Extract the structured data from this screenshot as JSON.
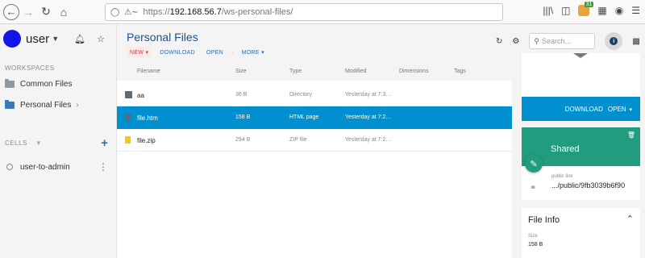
{
  "browser": {
    "url_prefix": "https://",
    "url_host": "192.168.56.7",
    "url_path": "/ws-personal-files/",
    "ext_badge": "31"
  },
  "user": {
    "name": "user"
  },
  "sidebar": {
    "workspaces_title": "WORKSPACES",
    "workspaces": [
      {
        "label": "Common Files"
      },
      {
        "label": "Personal Files"
      }
    ],
    "cells_title": "CELLS",
    "cells": [
      {
        "label": "user-to-admin"
      }
    ]
  },
  "main": {
    "title": "Personal Files",
    "toolbar": {
      "new": "NEW",
      "download": "DOWNLOAD",
      "open": "OPEN",
      "more": "MORE"
    },
    "columns": [
      "Filename",
      "Size",
      "Type",
      "Modified",
      "Dimensions",
      "Tags"
    ],
    "rows": [
      {
        "name": "aa",
        "size": "36 B",
        "type": "Directory",
        "modified": "Yesterday at 7:3…",
        "icon": "folder-icon",
        "selected": false
      },
      {
        "name": "file.htm",
        "size": "158 B",
        "type": "HTML page",
        "modified": "Yesterday at 7:2…",
        "icon": "document-icon",
        "selected": true
      },
      {
        "name": "file.zip",
        "size": "294 B",
        "type": "ZIP file",
        "modified": "Yesterday at 7:2…",
        "icon": "archive-icon",
        "selected": false
      }
    ]
  },
  "header": {
    "search_placeholder": "Search..."
  },
  "details": {
    "download": "DOWNLOAD",
    "open": "OPEN",
    "shared_title": "Shared",
    "public_link_label": "public link",
    "public_link_value": ".../public/9fb3039b6f90",
    "file_info_title": "File Info",
    "size_label": "Size",
    "size_value": "158 B"
  },
  "colors": {
    "accent": "#0090d0",
    "shared": "#219c7f",
    "title": "#1f4f86",
    "new": "#d23a3a"
  }
}
